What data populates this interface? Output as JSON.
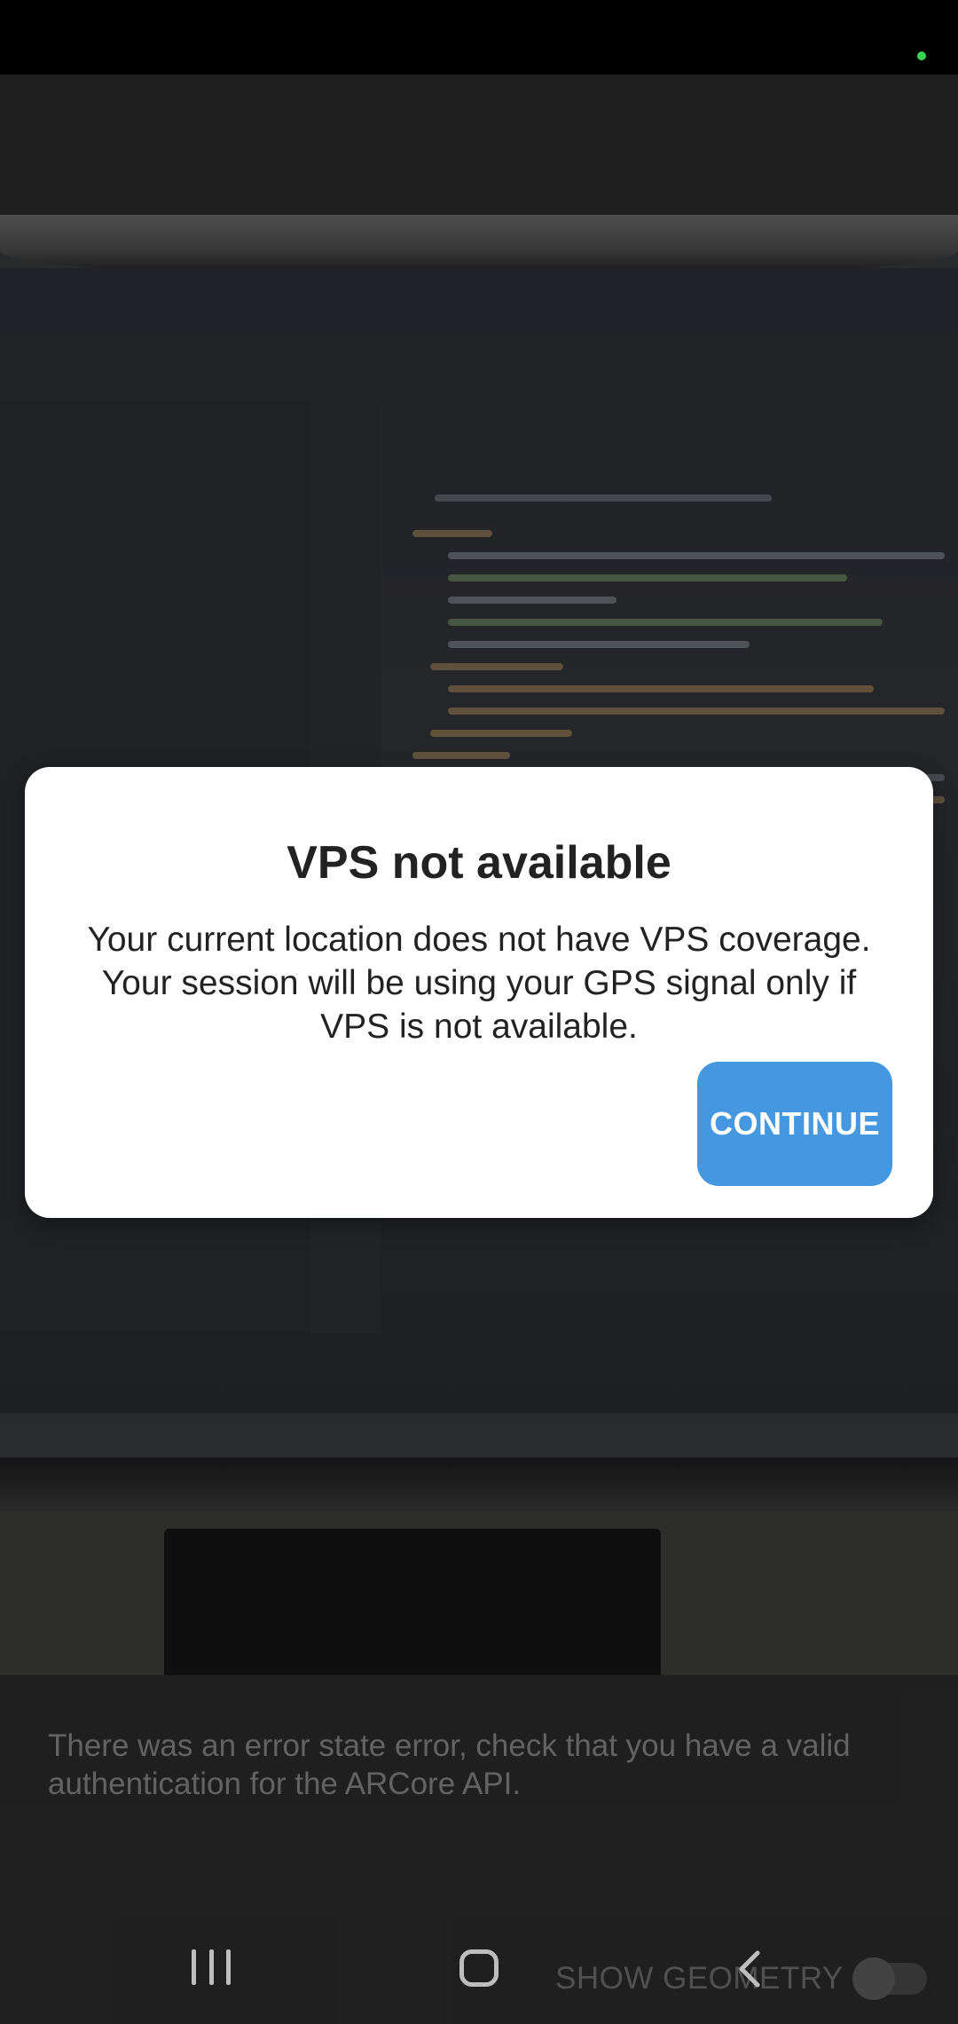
{
  "dialog": {
    "title": "VPS not available",
    "message": "Your current location does not have VPS coverage. Your session will be using your GPS signal only if VPS is not available.",
    "continue_label": "CONTINUE"
  },
  "bottom_panel": {
    "error_message": "There was an error state error, check that you have a valid authentication for the ARCore API.",
    "show_geometry_label": "SHOW GEOMETRY",
    "show_geometry_enabled": false
  },
  "nav_bar": {
    "recents_icon": "recents-icon",
    "home_icon": "home-icon",
    "back_icon": "back-icon"
  },
  "colors": {
    "accent": "#4597e0",
    "privacy_indicator": "#39d353"
  }
}
